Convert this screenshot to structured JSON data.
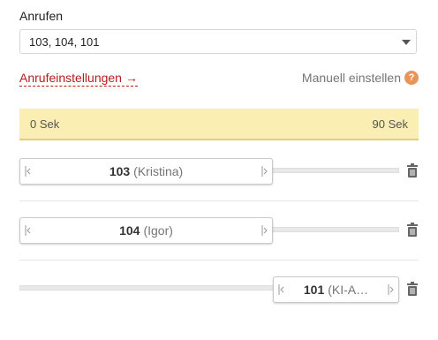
{
  "form": {
    "label": "Anrufen",
    "select_value": "103, 104, 101"
  },
  "links": {
    "settings_label": "Anrufeinstellungen",
    "settings_arrow": "→",
    "manual_label": "Manuell einstellen",
    "help_glyph": "?"
  },
  "timeline": {
    "start_label": "0 Sek",
    "end_label": "90 Sek"
  },
  "rows": [
    {
      "number": "103",
      "name": "(Kristina)"
    },
    {
      "number": "104",
      "name": "(Igor)"
    },
    {
      "number": "101",
      "name": "(KI-A…"
    }
  ],
  "colors": {
    "link": "#b71c1c",
    "timeline_bg": "#fbeeb3",
    "help_icon": "#e8955b"
  }
}
